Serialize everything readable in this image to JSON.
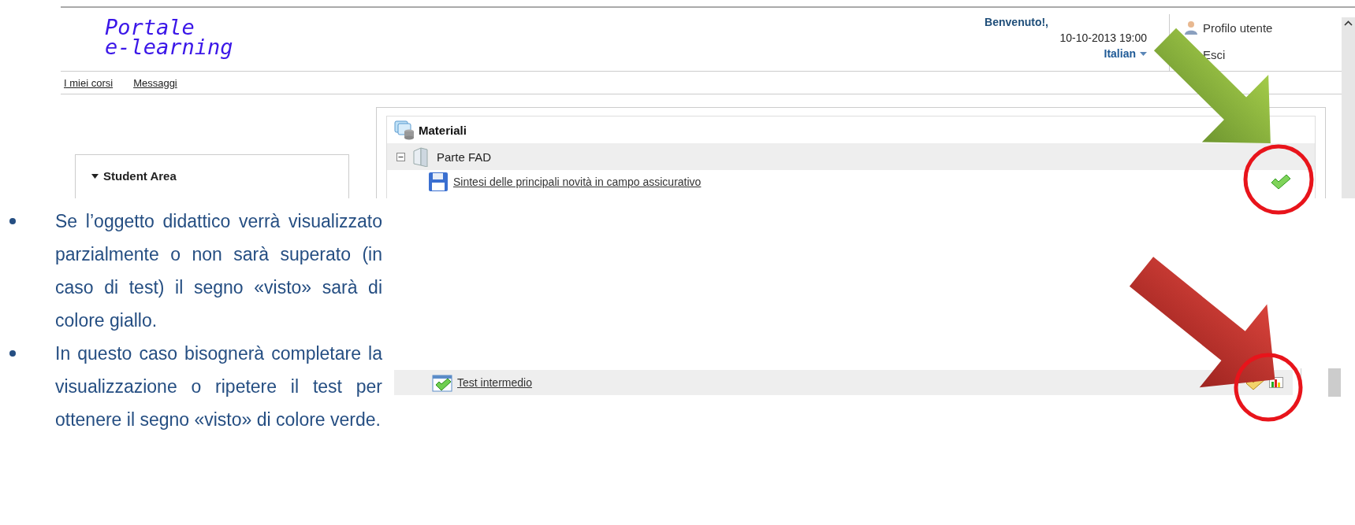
{
  "header": {
    "logo_line_1": "Portale",
    "logo_line_2": "e-learning",
    "greeting": "Benvenuto!,",
    "datetime": "10-10-2013 19:00",
    "language": "Italian",
    "user_menu": [
      "Profilo utente",
      "Esci"
    ]
  },
  "nav": {
    "links": [
      "I miei corsi",
      "Messaggi"
    ]
  },
  "sidebar": {
    "title": "Student Area",
    "expanded": true
  },
  "materials": {
    "title": "Materiali",
    "folder": {
      "label": "Parte FAD",
      "expanded": true,
      "items": [
        {
          "label": "Sintesi delle principali novità in campo assicurativo",
          "completed": true
        }
      ]
    }
  },
  "test_item": {
    "label": "Test intermedio",
    "completed": false
  },
  "notes": [
    "Se l’oggetto didattico verrà visualizzato parzialmente o non sarà superato (in caso di test) il segno «visto» sarà di colore giallo.",
    "In questo caso bisognerà completare la visualizzazione o ripetere il test per ottenere il segno «visto» di colore verde."
  ]
}
